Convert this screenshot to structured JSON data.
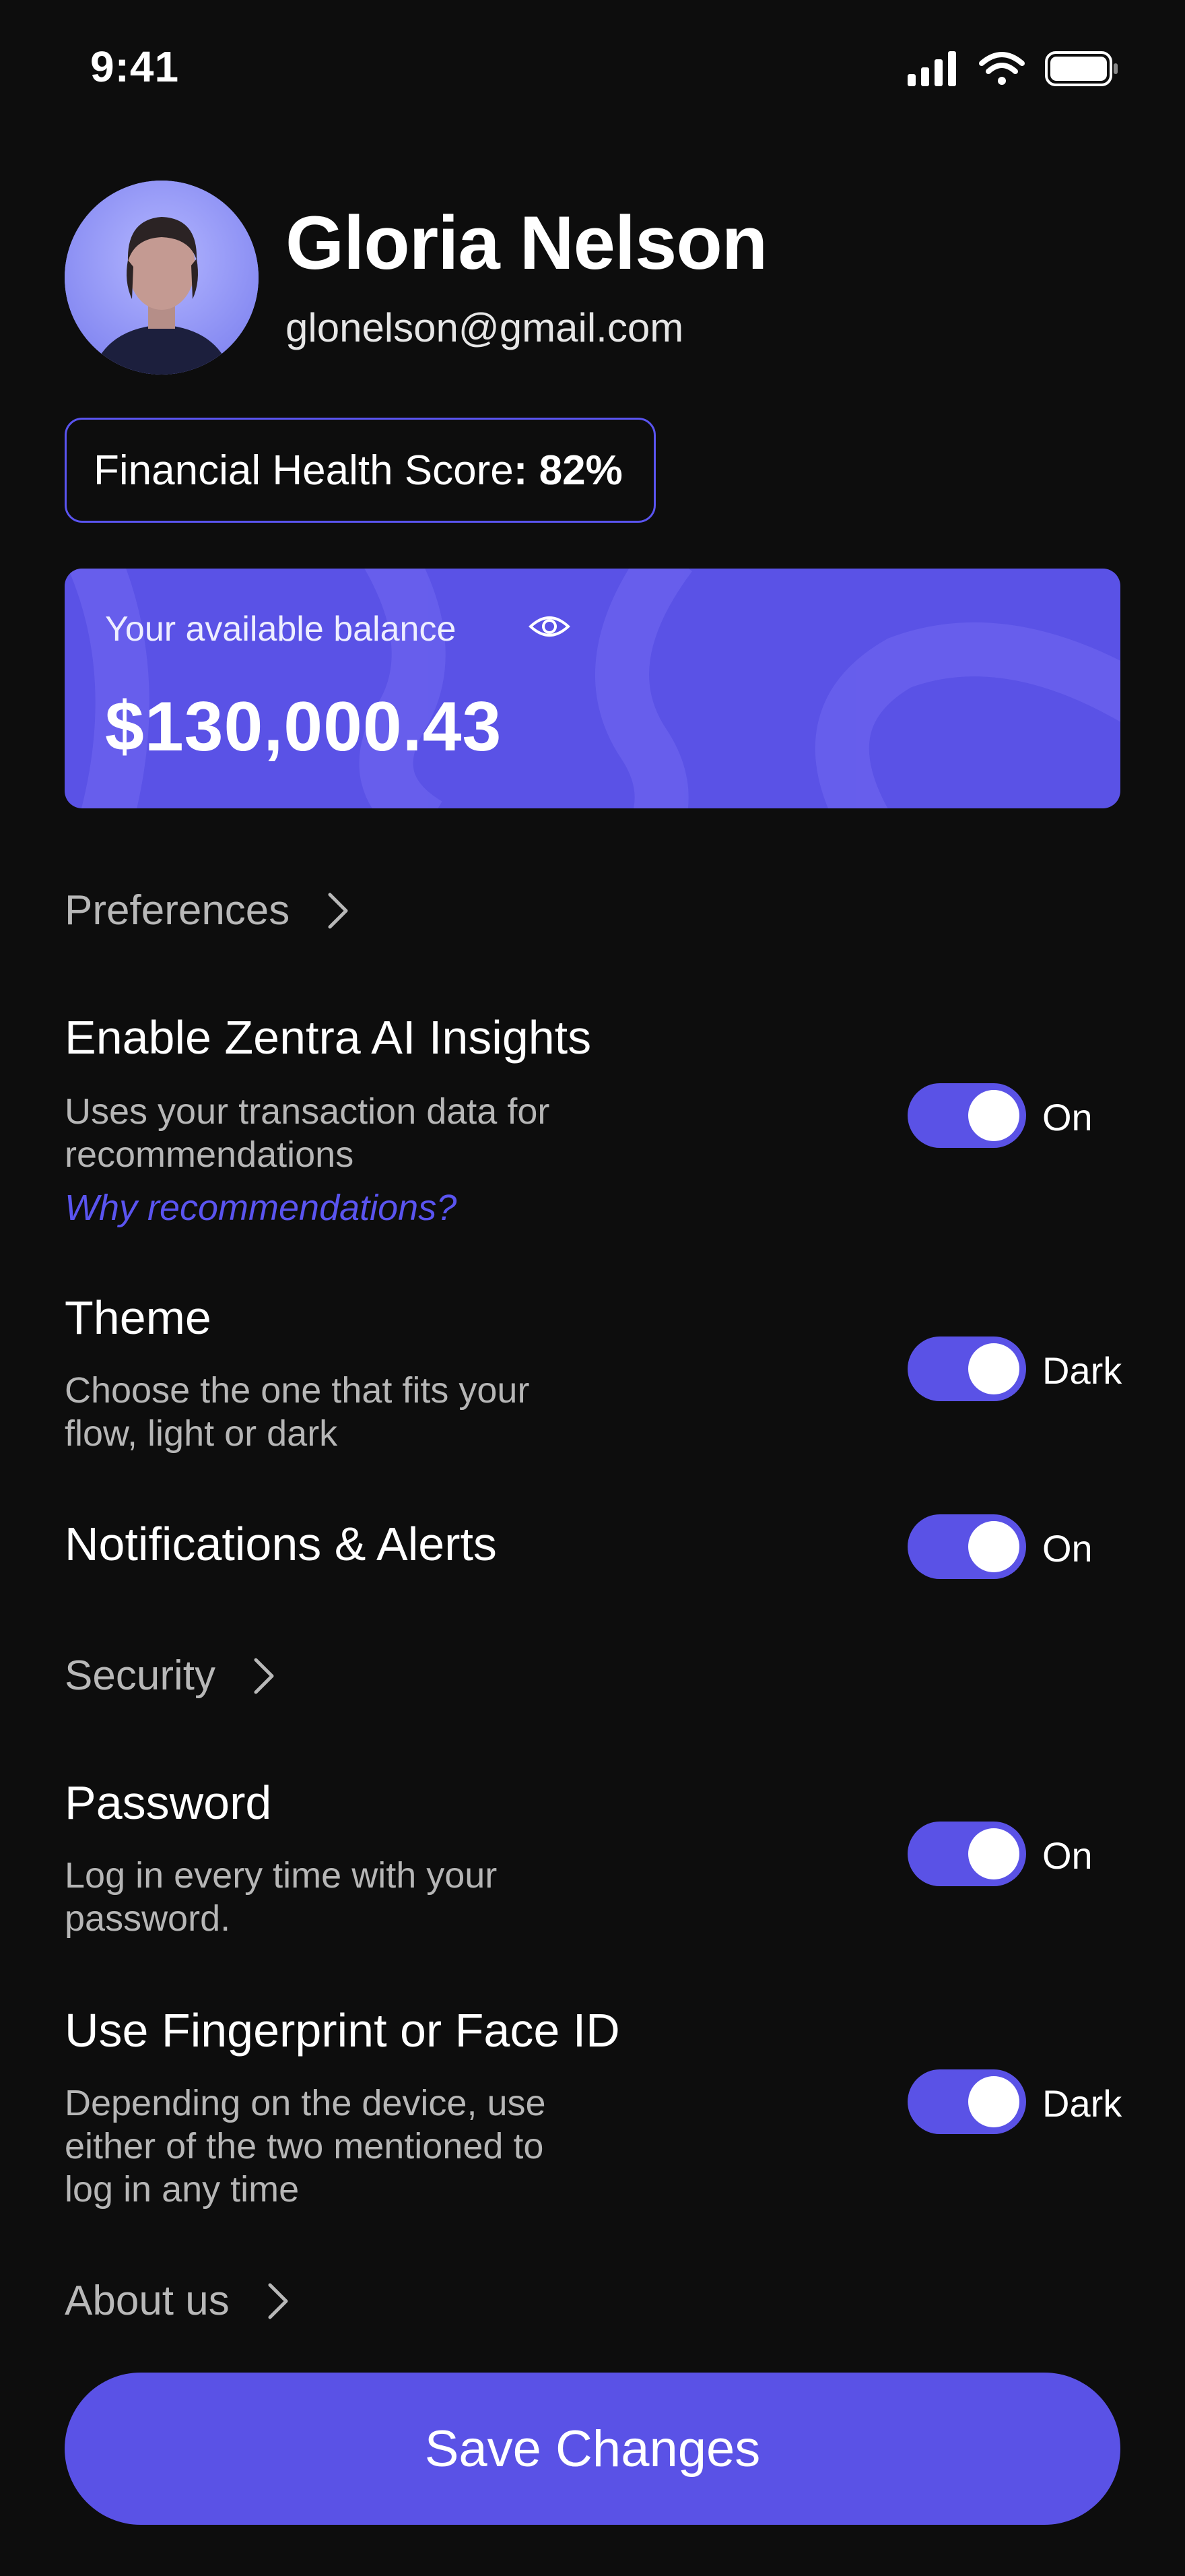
{
  "status_bar": {
    "time": "9:41"
  },
  "profile": {
    "name": "Gloria Nelson",
    "email": "glonelson@gmail.com"
  },
  "score": {
    "label": "Financial Health Score",
    "value": "82%"
  },
  "balance": {
    "label": "Your available balance",
    "amount": "$130,000.43"
  },
  "sections": {
    "preferences": "Preferences",
    "security": "Security",
    "about": "About us"
  },
  "settings": {
    "ai": {
      "title": "Enable Zentra AI Insights",
      "desc_line1": "Uses your transaction data for",
      "desc_line2": "recommendations",
      "link": "Why recommendations?",
      "state": "On"
    },
    "theme": {
      "title": "Theme",
      "desc_line1": "Choose the one that fits your",
      "desc_line2": "flow, light or dark",
      "state": "Dark"
    },
    "notifications": {
      "title": "Notifications & Alerts",
      "state": "On"
    },
    "password": {
      "title": "Password",
      "desc_line1": "Log in every time with your",
      "desc_line2": "password.",
      "state": "On"
    },
    "biometric": {
      "title": "Use Fingerprint or Face ID",
      "desc_line1": "Depending on the device, use",
      "desc_line2": "either of the two mentioned to",
      "desc_line3": "log in any time",
      "state": "Dark"
    }
  },
  "actions": {
    "save_label": "Save Changes"
  },
  "colors": {
    "accent": "#5a52e6",
    "background": "#0d0d0d",
    "link": "#5a54f0"
  },
  "icons": {
    "signal": "cellular-signal-icon",
    "wifi": "wifi-icon",
    "battery": "battery-icon",
    "eye": "eye-icon",
    "chevron": "chevron-right-icon"
  }
}
